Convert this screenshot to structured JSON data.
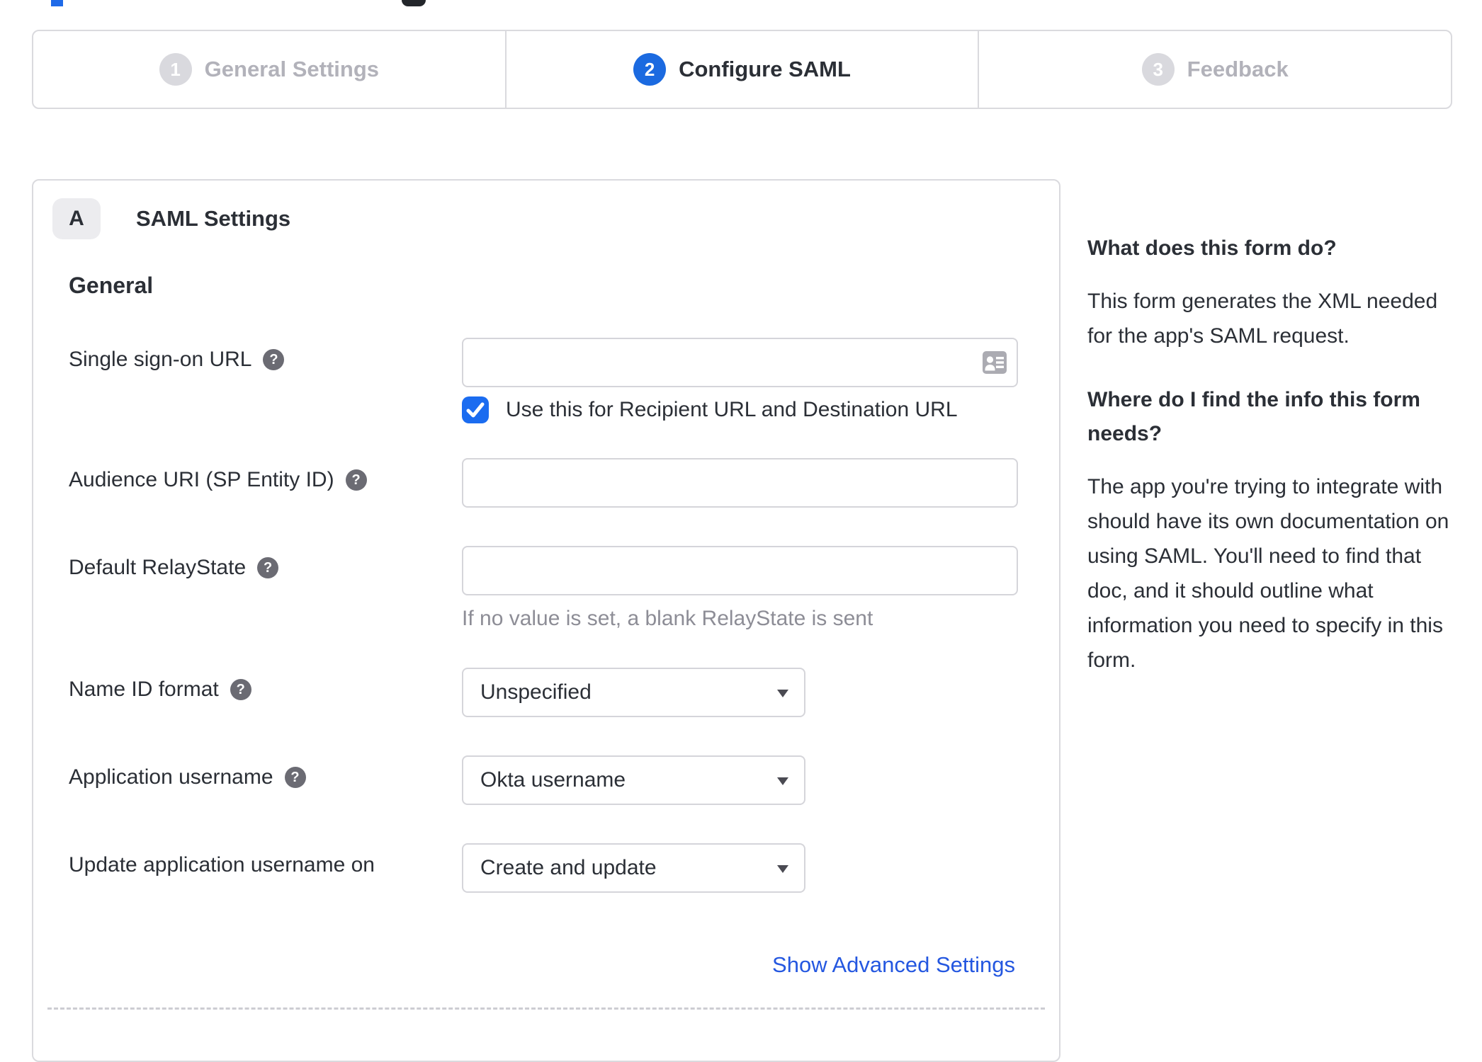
{
  "colors": {
    "accent_blue": "#1b6cf0",
    "step_active_blue": "#1b6ae0",
    "link_blue": "#2457e0",
    "inactive_gray": "#d9d9de",
    "text_dark": "#2b2f36",
    "muted_text": "#8d8d96",
    "border_gray": "#dadade"
  },
  "stepper": {
    "steps": [
      {
        "number": "1",
        "label": "General Settings",
        "state": "inactive"
      },
      {
        "number": "2",
        "label": "Configure SAML",
        "state": "active"
      },
      {
        "number": "3",
        "label": "Feedback",
        "state": "inactive"
      }
    ]
  },
  "panel": {
    "badge": "A",
    "title": "SAML Settings",
    "section": "General",
    "fields": {
      "sso": {
        "label": "Single sign-on URL",
        "value": "",
        "checkbox_label": "Use this for Recipient URL and Destination URL",
        "checked": true
      },
      "audience": {
        "label": "Audience URI (SP Entity ID)",
        "value": ""
      },
      "relay": {
        "label": "Default RelayState",
        "value": "",
        "hint": "If no value is set, a blank RelayState is sent"
      },
      "name_id": {
        "label": "Name ID format",
        "value": "Unspecified"
      },
      "app_username": {
        "label": "Application username",
        "value": "Okta username"
      },
      "update_username": {
        "label": "Update application username on",
        "value": "Create and update"
      }
    },
    "advanced_link": "Show Advanced Settings"
  },
  "sidebar": {
    "q1": {
      "heading": "What does this form do?",
      "body": "This form generates the XML needed for the app's SAML request."
    },
    "q2": {
      "heading": "Where do I find the info this form needs?",
      "body": "The app you're trying to integrate with should have its own documentation on using SAML. You'll need to find that doc, and it should outline what information you need to specify in this form."
    }
  },
  "icons": {
    "help": "?"
  }
}
